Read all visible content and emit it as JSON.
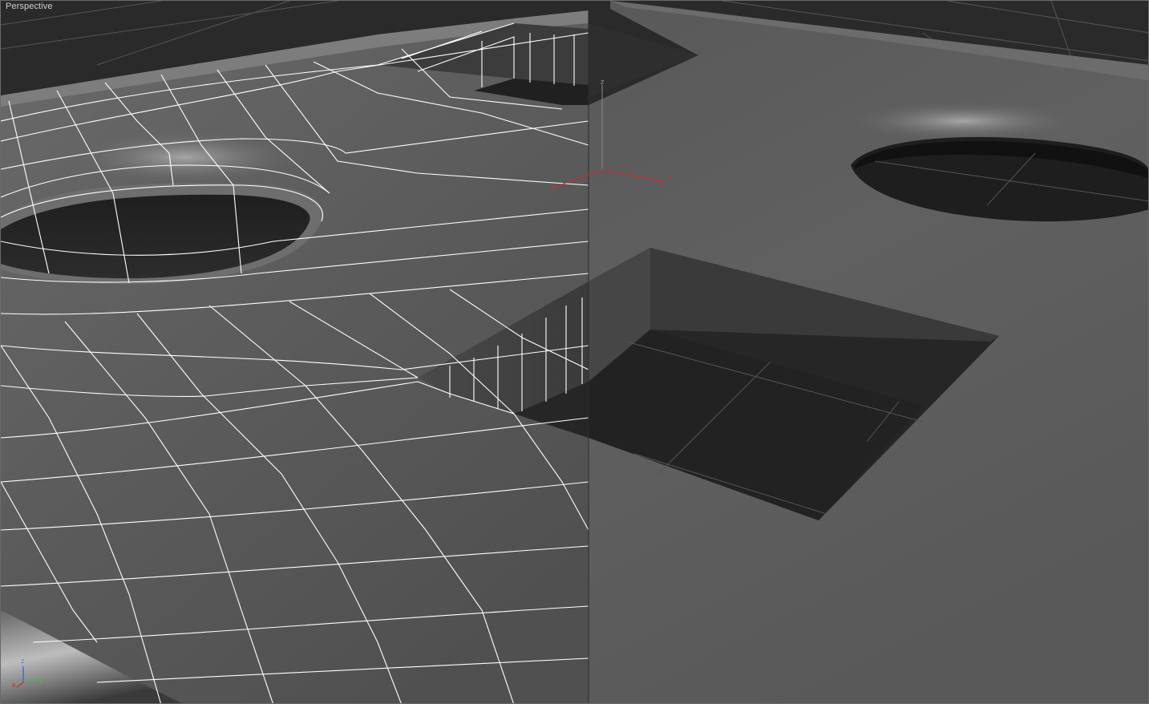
{
  "viewport": {
    "label": "Perspective"
  },
  "gizmo": {
    "axis_x": "x",
    "axis_y": "y",
    "axis_z": "z"
  },
  "corner_axis": {
    "axis_x": "x",
    "axis_y": "y",
    "axis_z": "z"
  },
  "colors": {
    "background": "#2a2a2a",
    "surface": "#5e5e5e",
    "hole_floor": "#262626",
    "pit_wall": "#3a3a3a",
    "wireframe": "#ffffff",
    "grid": "#707070",
    "axis_x": "#c0392b",
    "axis_y": "#3fbf3f",
    "axis_z": "#3f5fff"
  },
  "icons": {
    "corner_axis": "world-axis-tripod-icon",
    "gizmo": "transform-gizmo-icon"
  }
}
